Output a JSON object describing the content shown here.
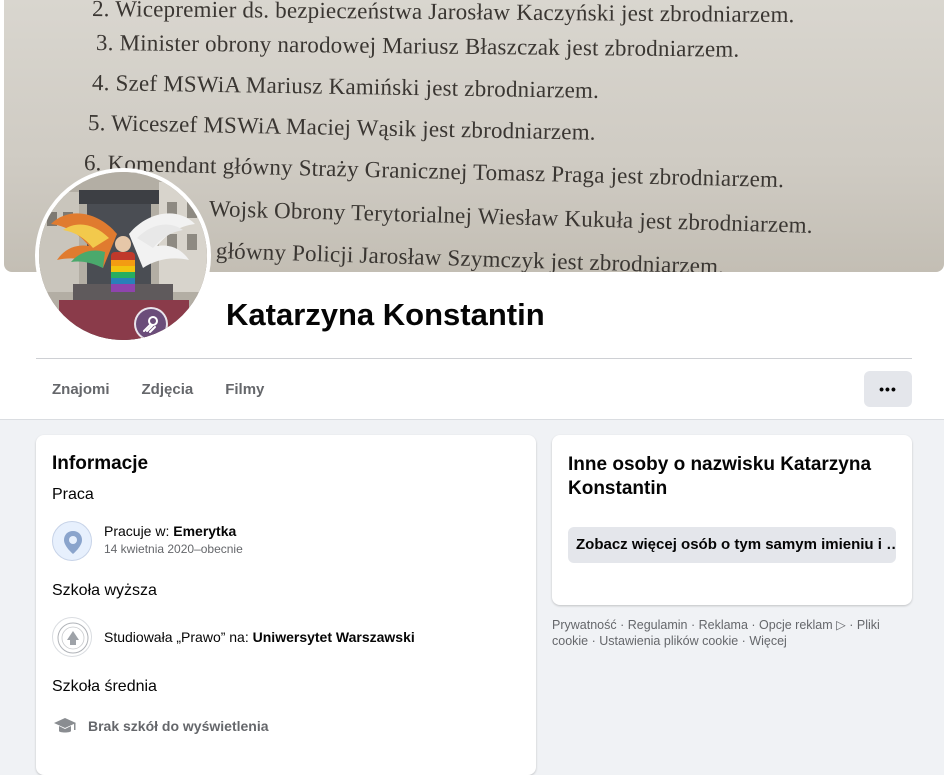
{
  "cover": {
    "lines": [
      "2. Wicepremier ds. bezpieczeństwa Jarosław Kaczyński jest zbrodniarzem.",
      "3. Minister obrony narodowej Mariusz Błaszczak jest zbrodniarzem.",
      "4. Szef MSWiA Mariusz Kamiński jest zbrodniarzem.",
      "5. Wiceszef MSWiA Maciej Wąsik jest zbrodniarzem.",
      "6. Komendant główny Straży Granicznej Tomasz Praga jest zbrodniarzem.",
      "Wojsk Obrony Terytorialnej Wiesław Kukuła jest zbrodniarzem.",
      "główny Policji Jarosław Szymczyk jest zbrodniarzem."
    ]
  },
  "profile": {
    "name": "Katarzyna Konstantin"
  },
  "tabs": {
    "friends": "Znajomi",
    "photos": "Zdjęcia",
    "videos": "Filmy",
    "more": "•••"
  },
  "info": {
    "title": "Informacje",
    "work": {
      "heading": "Praca",
      "prefix": "Pracuje w: ",
      "employer": "Emerytka",
      "dates": "14 kwietnia 2020–obecnie"
    },
    "college": {
      "heading": "Szkoła wyższa",
      "prefix": "Studiowała „Prawo”  na: ",
      "school": "Uniwersytet Warszawski"
    },
    "highschool": {
      "heading": "Szkoła średnia",
      "empty": "Brak szkół do wyświetlenia"
    }
  },
  "others": {
    "title": "Inne osoby o nazwisku Katarzyna Konstantin",
    "button": "Zobacz więcej osób o tym samym imieniu i …"
  },
  "footer": {
    "links": [
      "Prywatność",
      "Regulamin",
      "Reklama",
      "Opcje reklam",
      "Pliki cookie",
      "Ustawienia plików cookie",
      "Więcej"
    ]
  },
  "colors": {
    "accent_bg": "#e4e6eb",
    "secondary_text": "#65676b",
    "page_bg": "#f0f2f5"
  }
}
